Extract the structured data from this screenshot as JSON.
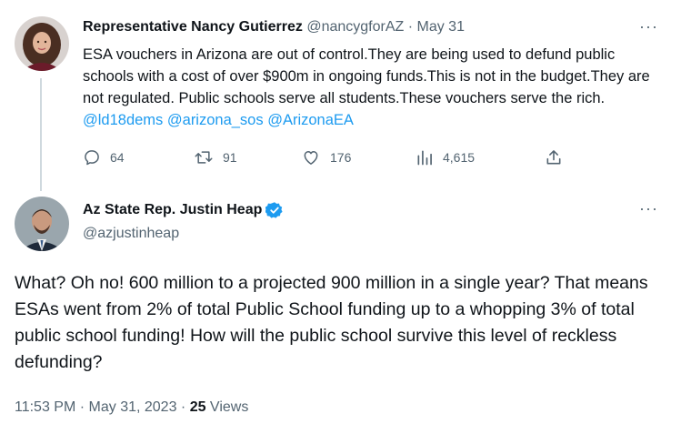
{
  "tweet1": {
    "author_name": "Representative Nancy Gutierrez",
    "handle": "@nancygforAZ",
    "separator": " · ",
    "date": "May 31",
    "more_label": "···",
    "text": "ESA vouchers in Arizona are out of control.They are being used to defund public schools with a cost of over $900m in ongoing funds.This is not in the budget.They are not regulated. Public schools serve all students.These vouchers serve the rich. ",
    "mentions": [
      "@ld18dems",
      "@arizona_sos",
      "@ArizonaEA"
    ],
    "actions": {
      "reply_count": "64",
      "retweet_count": "91",
      "like_count": "176",
      "view_count": "4,615"
    }
  },
  "tweet2": {
    "author_name": "Az State Rep. Justin Heap",
    "handle": "@azjustinheap",
    "more_label": "···",
    "verified": true,
    "text": "What? Oh no! 600 million to a projected 900 million in a single year? That means ESAs went from 2% of total Public School funding up to a whopping 3% of total public school funding! How will the public school survive this level of reckless defunding?",
    "time": "11:53 PM",
    "date": "May 31, 2023",
    "separator": " · ",
    "views_count": "25",
    "views_label": " Views"
  },
  "icons": {
    "reply": "reply-icon",
    "retweet": "retweet-icon",
    "like": "heart-icon",
    "views": "views-icon",
    "share": "share-icon",
    "verified": "verified-badge-icon"
  },
  "colors": {
    "accent": "#1d9bf0",
    "text": "#0f1419",
    "muted": "#536471",
    "line": "#cfd9de"
  }
}
